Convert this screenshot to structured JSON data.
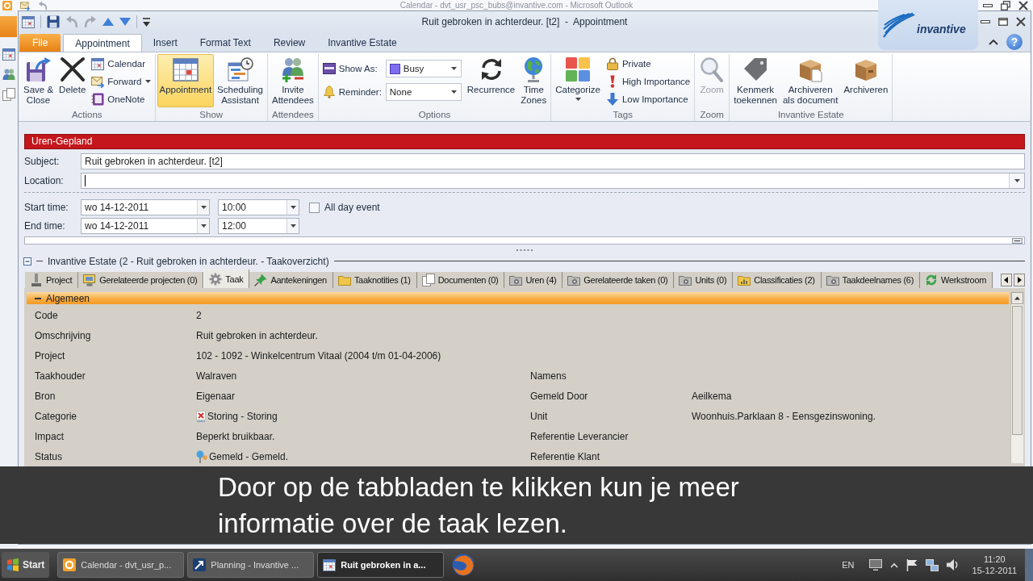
{
  "background_window": {
    "title": "Calendar - dvt_usr_psc_bubs@invantive.com - Microsoft Outlook"
  },
  "window": {
    "title": "Ruit gebroken in achterdeur. [t2]  -  Appointment"
  },
  "logo": {
    "text": "invantive"
  },
  "ribbon": {
    "tabs": [
      {
        "label": "File",
        "kind": "file",
        "selected": false
      },
      {
        "label": "Appointment",
        "kind": "tab",
        "selected": true
      },
      {
        "label": "Insert",
        "kind": "tab",
        "selected": false
      },
      {
        "label": "Format Text",
        "kind": "tab",
        "selected": false
      },
      {
        "label": "Review",
        "kind": "tab",
        "selected": false
      },
      {
        "label": "Invantive Estate",
        "kind": "tab",
        "selected": false
      }
    ],
    "help": "?",
    "groups": [
      {
        "label": "Actions",
        "large": [
          {
            "label": "Save &\nClose"
          },
          {
            "label": "Delete"
          }
        ],
        "small": [
          {
            "label": "Calendar",
            "dropdown": false
          },
          {
            "label": "Forward",
            "dropdown": true
          },
          {
            "label": "OneNote",
            "dropdown": false
          }
        ]
      },
      {
        "label": "Show",
        "large": [
          {
            "label": "Appointment",
            "selected": true
          },
          {
            "label": "Scheduling\nAssistant",
            "selected": false
          }
        ]
      },
      {
        "label": "Attendees",
        "large": [
          {
            "label": "Invite\nAttendees"
          }
        ]
      },
      {
        "label": "Options",
        "fields": [
          {
            "label": "Show As:",
            "value": "Busy"
          },
          {
            "label": "Reminder:",
            "value": "None"
          }
        ],
        "large": [
          {
            "label": "Recurrence"
          },
          {
            "label": "Time\nZones"
          }
        ]
      },
      {
        "label": "Tags",
        "large": [
          {
            "label": "Categorize",
            "dropdown": true
          }
        ],
        "small": [
          {
            "label": "Private"
          },
          {
            "label": "High Importance"
          },
          {
            "label": "Low Importance"
          }
        ]
      },
      {
        "label": "Zoom",
        "large": [
          {
            "label": "Zoom",
            "disabled": true
          }
        ]
      },
      {
        "label": "Invantive Estate",
        "large": [
          {
            "label": "Kenmerk\ntoekennen"
          },
          {
            "label": "Archiveren\nals document"
          },
          {
            "label": "Archiveren"
          }
        ]
      }
    ]
  },
  "form": {
    "banner": "Uren-Gepland",
    "subject": {
      "label": "Subject:",
      "value": "Ruit gebroken in achterdeur. [t2]"
    },
    "location": {
      "label": "Location:"
    },
    "times": [
      {
        "label": "Start time:",
        "date": "wo 14-12-2011",
        "time": "10:00"
      },
      {
        "label": "End time:",
        "date": "wo 14-12-2011",
        "time": "12:00"
      }
    ],
    "all_day": {
      "label": "All day event",
      "checked": false
    }
  },
  "estate": {
    "title": "Invantive Estate (2 - Ruit gebroken in achterdeur. - Taakoverzicht)",
    "expanded": true,
    "tabs": [
      {
        "label": "Project",
        "selected": false
      },
      {
        "label": "Gerelateerde projecten (0)",
        "selected": false
      },
      {
        "label": "Taak",
        "selected": true
      },
      {
        "label": "Aantekeningen",
        "selected": false
      },
      {
        "label": "Taaknotities (1)",
        "selected": false
      },
      {
        "label": "Documenten (0)",
        "selected": false
      },
      {
        "label": "Uren (4)",
        "selected": false
      },
      {
        "label": "Gerelateerde taken (0)",
        "selected": false
      },
      {
        "label": "Units (0)",
        "selected": false
      },
      {
        "label": "Classificaties (2)",
        "selected": false
      },
      {
        "label": "Taakdeelnames (6)",
        "selected": false
      },
      {
        "label": "Werkstroom",
        "selected": false
      }
    ],
    "section": {
      "title": "Algemeen",
      "expanded": true
    },
    "rows": [
      {
        "kind": "text",
        "label": "Code",
        "value": "2"
      },
      {
        "kind": "text",
        "label": "Omschrijving",
        "value": "Ruit gebroken in achterdeur."
      },
      {
        "kind": "text",
        "label": "Project",
        "value": "102 - 1092 - Winkelcentrum Vitaal (2004 t/m 01-04-2006)"
      },
      {
        "kind": "text",
        "label": "Taakhouder",
        "value": "Walraven",
        "right": {
          "label": "Namens"
        }
      },
      {
        "kind": "text",
        "label": "Bron",
        "value": "Eigenaar",
        "right": {
          "label": "Gemeld Door",
          "value": "Aeilkema"
        }
      },
      {
        "kind": "category",
        "label": "Categorie",
        "value": "Storing - Storing",
        "right": {
          "label": "Unit",
          "value": "Woonhuis.Parklaan 8 - Eensgezinswoning."
        }
      },
      {
        "kind": "text",
        "label": "Impact",
        "value": "Beperkt bruikbaar.",
        "right": {
          "label": "Referentie Leverancier"
        }
      },
      {
        "kind": "status",
        "label": "Status",
        "value": "Gemeld - Gemeld.",
        "right": {
          "label": "Referentie Klant"
        }
      }
    ]
  },
  "caption": {
    "text": "Door op de tabbladen te klikken kun je meer\ninformatie over de taak lezen."
  },
  "taskbar": {
    "start": "Start",
    "tasks": [
      {
        "label": "Calendar - dvt_usr_p...",
        "selected": false
      },
      {
        "label": "Planning - Invantive ...",
        "selected": false
      },
      {
        "label": "Ruit gebroken in a...",
        "selected": true
      }
    ],
    "language": "EN",
    "time": "11:20",
    "date": "15-12-2011"
  }
}
